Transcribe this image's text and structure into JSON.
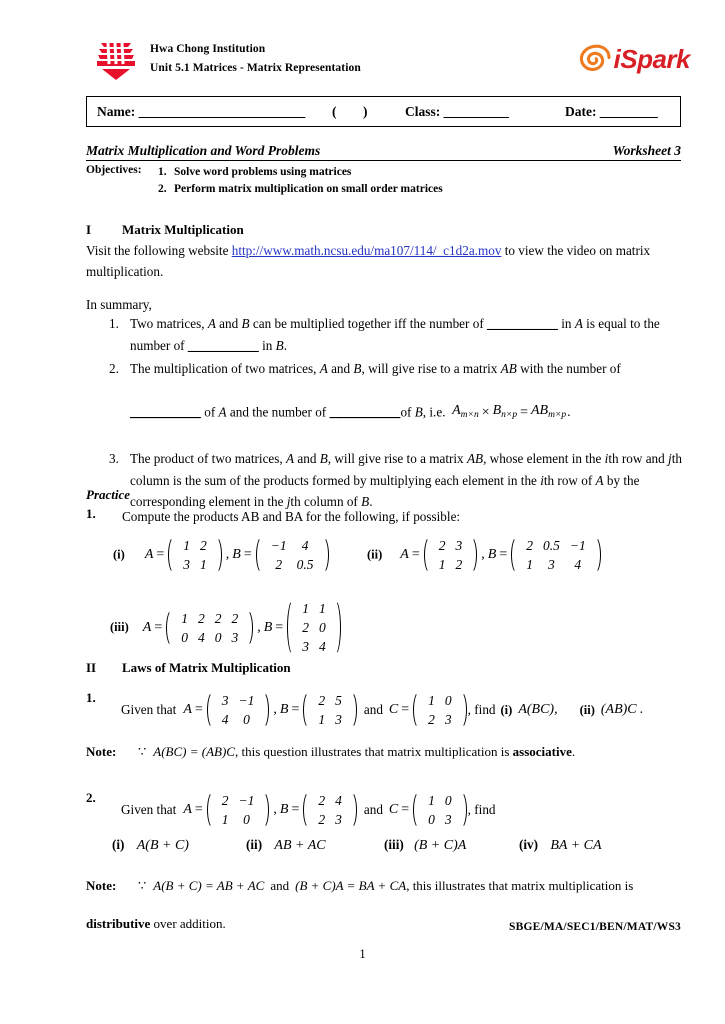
{
  "header": {
    "school": "Hwa Chong Institution",
    "unit": "Unit 5.1 Matrices - Matrix Representation",
    "brand_logo_text": "iSpark",
    "brand_color": "#d81f26",
    "logo_color": "#e8112d",
    "spiral_color": "#ef7b21"
  },
  "namebox": {
    "name_label": "Name:",
    "name_fill": "_______________________",
    "paren_open": "(",
    "paren_close": ")",
    "class_label": "Class:",
    "class_fill": "_________",
    "date_label": "Date:",
    "date_fill": "________"
  },
  "title": {
    "main": "Matrix Multiplication and Word Problems",
    "right": "Worksheet 3"
  },
  "objectives": {
    "label": "Objectives:",
    "items": [
      {
        "num": "1.",
        "text": "Solve word problems using matrices"
      },
      {
        "num": "2.",
        "text": "Perform matrix multiplication on small order matrices"
      }
    ]
  },
  "section1": {
    "numeral": "I",
    "heading": "Matrix Multiplication",
    "intro_before": "Visit the following website ",
    "link": "http://www.math.ncsu.edu/ma107/114/_c1d2a.mov",
    "intro_after": " to view the video on matrix multiplication.",
    "summary_lead": "In summary,",
    "items": [
      {
        "num": "1.",
        "parts": [
          "Two matrices, ",
          "A",
          " and ",
          "B",
          " can be multiplied together iff the number of ",
          "__________",
          " in ",
          "A",
          " is equal to the number of ",
          "__________",
          " in ",
          "B",
          "."
        ]
      },
      {
        "num": "2.",
        "lead": "The multiplication of two matrices, A and B, will give rise to a matrix AB with the number of",
        "blank1": "__________",
        "mid1": " of A and the number of ",
        "blank2": "__________",
        "mid2": "of B, i.e. ",
        "formula": "A_{m×n} × B_{n×p} = AB_{m×p} ."
      },
      {
        "num": "3.",
        "text": "The product of two matrices, A and B, will give rise to a matrix AB, whose element in the ith row and jth column is the sum of the products formed by multiplying each element in the ith row of A by the corresponding element in the jth column of B."
      }
    ]
  },
  "practice": {
    "heading": "Practice",
    "q1_num": "1.",
    "q1_text": "Compute the products AB and BA for the following, if possible:",
    "parts": [
      {
        "tag": "(i)",
        "matrices": [
          {
            "name": "A",
            "rows": [
              [
                "1",
                "2"
              ],
              [
                "3",
                "1"
              ]
            ]
          },
          {
            "name": "B",
            "rows": [
              [
                "−1",
                "4"
              ],
              [
                "2",
                "0.5"
              ]
            ]
          }
        ]
      },
      {
        "tag": "(ii)",
        "matrices": [
          {
            "name": "A",
            "rows": [
              [
                "2",
                "3"
              ],
              [
                "1",
                "2"
              ]
            ]
          },
          {
            "name": "B",
            "rows": [
              [
                "2",
                "0.5",
                "−1"
              ],
              [
                "1",
                "3",
                "4"
              ]
            ]
          }
        ]
      },
      {
        "tag": "(iii)",
        "matrices": [
          {
            "name": "A",
            "rows": [
              [
                "1",
                "2",
                "2",
                "2"
              ],
              [
                "0",
                "4",
                "0",
                "3"
              ]
            ]
          },
          {
            "name": "B",
            "rows": [
              [
                "1",
                "1"
              ],
              [
                "2",
                "0"
              ],
              [
                "3",
                "4"
              ]
            ]
          }
        ]
      }
    ]
  },
  "section2": {
    "numeral": "II",
    "heading": "Laws of Matrix Multiplication",
    "q1": {
      "num": "1.",
      "lead": "Given that",
      "A": {
        "name": "A",
        "rows": [
          [
            "3",
            "−1"
          ],
          [
            "4",
            "0"
          ]
        ]
      },
      "B": {
        "name": "B",
        "rows": [
          [
            "2",
            "5"
          ],
          [
            "1",
            "3"
          ]
        ]
      },
      "and": "and",
      "C": {
        "name": "C",
        "rows": [
          [
            "1",
            "0"
          ],
          [
            "2",
            "3"
          ]
        ]
      },
      "find": ", find",
      "i_tag": "(i)",
      "i_expr": "A(BC)",
      "comma": ",",
      "ii_tag": "(ii)",
      "ii_expr": "(AB)C",
      "period": "."
    },
    "note1": {
      "label": "Note:",
      "because": "∵",
      "expr": "A(BC) = (AB)C",
      "text_mid": ", this question illustrates that matrix multiplication is ",
      "bold_word": "associative",
      "end": "."
    },
    "q2": {
      "num": "2.",
      "lead": "Given that",
      "A": {
        "name": "A",
        "rows": [
          [
            "2",
            "−1"
          ],
          [
            "1",
            "0"
          ]
        ]
      },
      "B": {
        "name": "B",
        "rows": [
          [
            "2",
            "4"
          ],
          [
            "2",
            "3"
          ]
        ]
      },
      "and": "and",
      "C": {
        "name": "C",
        "rows": [
          [
            "1",
            "0"
          ],
          [
            "0",
            "3"
          ]
        ]
      },
      "find": ", find",
      "subparts": [
        {
          "tag": "(i)",
          "expr": "A(B + C)"
        },
        {
          "tag": "(ii)",
          "expr": "AB + AC"
        },
        {
          "tag": "(iii)",
          "expr": "(B + C)A"
        },
        {
          "tag": "(iv)",
          "expr": "BA + CA"
        }
      ]
    },
    "note2": {
      "label": "Note:",
      "because": "∵",
      "expr1": "A(B + C) = AB + AC",
      "and": "and",
      "expr2": "(B + C)A = BA + CA",
      "text_mid": ", this illustrates that matrix multiplication is",
      "bold_word": "distributive",
      "end": " over addition."
    }
  },
  "footer": {
    "code": "SBGE/MA/SEC1/BEN/MAT/WS3",
    "page_number": "1"
  }
}
